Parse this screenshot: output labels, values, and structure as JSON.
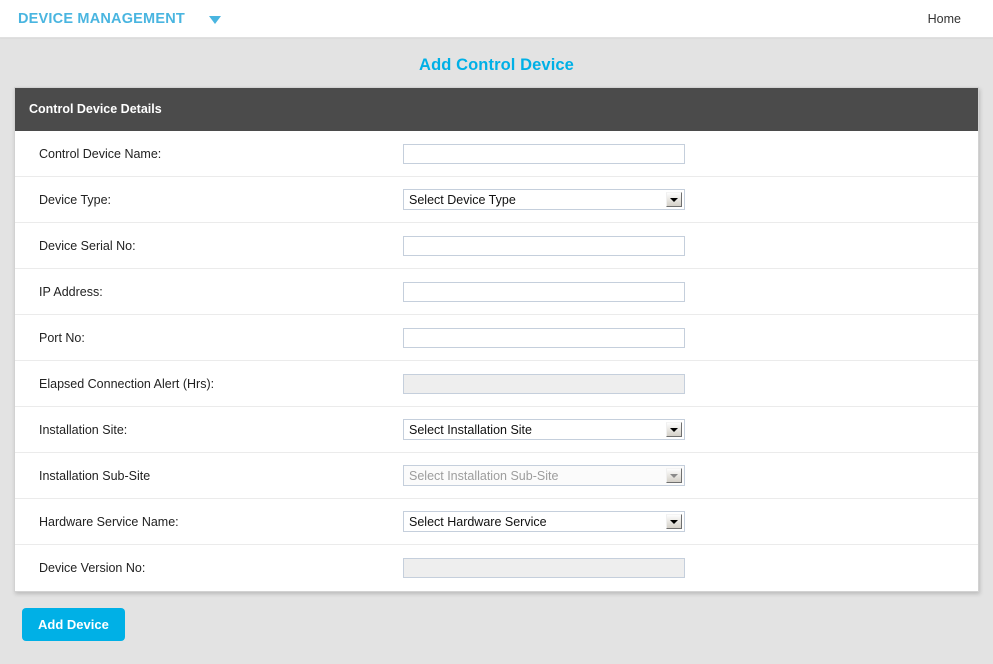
{
  "navbar": {
    "brand": "DEVICE MANAGEMENT",
    "caret_icon": "chevron-down-icon",
    "links": [
      {
        "label": "Home"
      }
    ]
  },
  "page": {
    "title": "Add Control Device",
    "title_color": "#00b0e6",
    "background_color": "#e3e3e3"
  },
  "panel": {
    "heading": "Control Device Details",
    "heading_bg": "#4b4b4b",
    "rows": [
      {
        "label": "Control Device Name:",
        "field": "text",
        "value": "",
        "placeholder": "",
        "disabled": false
      },
      {
        "label": "Device Type:",
        "field": "select",
        "value": "Select Device Type",
        "disabled": false
      },
      {
        "label": "Device Serial No:",
        "field": "text",
        "value": "",
        "placeholder": "",
        "disabled": false
      },
      {
        "label": "IP Address:",
        "field": "text",
        "value": "",
        "placeholder": "",
        "disabled": false
      },
      {
        "label": "Port No:",
        "field": "text",
        "value": "",
        "placeholder": "",
        "disabled": false
      },
      {
        "label": "Elapsed Connection Alert (Hrs):",
        "field": "text",
        "value": "",
        "placeholder": "",
        "disabled": true
      },
      {
        "label": "Installation Site:",
        "field": "select",
        "value": "Select Installation Site",
        "disabled": false
      },
      {
        "label": "Installation Sub-Site",
        "field": "select",
        "value": "Select Installation Sub-Site",
        "disabled": true
      },
      {
        "label": "Hardware Service Name:",
        "field": "select",
        "value": "Select Hardware Service",
        "disabled": false
      },
      {
        "label": "Device Version No:",
        "field": "text",
        "value": "",
        "placeholder": "",
        "disabled": true
      }
    ]
  },
  "actions": {
    "submit_label": "Add Device",
    "submit_color": "#00b0e6"
  }
}
